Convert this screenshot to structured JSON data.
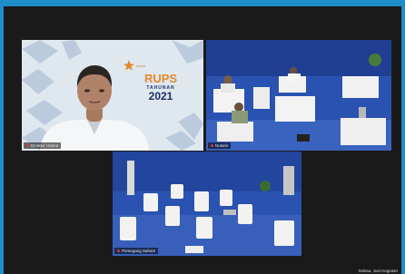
{
  "meeting": {
    "participants": [
      {
        "id": "speaker",
        "name": "Direktur Utama",
        "muted": true
      },
      {
        "id": "notary",
        "name": "Notaris",
        "muted": true
      },
      {
        "id": "shareholder",
        "name": "Pemegang Saham",
        "muted": true
      }
    ],
    "banner": {
      "brand": "suara",
      "title": "RUPS",
      "subtitle": "TAHUNAN",
      "year": "2021"
    },
    "bottom_right_text": "Selasa, Juni Kegiatan"
  },
  "colors": {
    "accent_blue": "#1e8fc9",
    "tile_bg": "#1a1a1a",
    "banner_orange": "#e4892a",
    "banner_navy": "#1c2f66",
    "stage_blue": "#2a52b0"
  }
}
